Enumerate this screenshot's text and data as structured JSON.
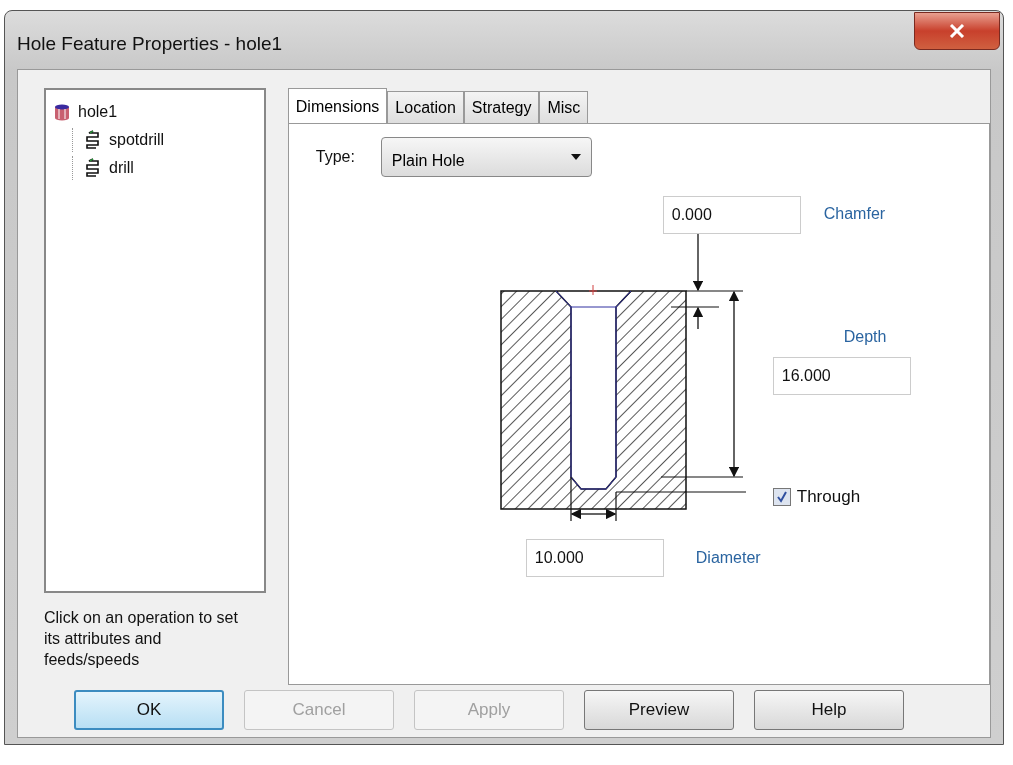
{
  "window": {
    "title": "Hole Feature Properties - hole1"
  },
  "tree": [
    {
      "label": "hole1",
      "kind": "feature",
      "children": [
        {
          "label": "spotdrill",
          "kind": "operation"
        },
        {
          "label": "drill",
          "kind": "operation"
        }
      ]
    }
  ],
  "hint": "Click on an operation to set its attributes and feeds/speeds",
  "tabs": [
    {
      "label": "Dimensions",
      "selected": true
    },
    {
      "label": "Location",
      "selected": false
    },
    {
      "label": "Strategy",
      "selected": false
    },
    {
      "label": "Misc",
      "selected": false
    }
  ],
  "type": {
    "label": "Type:",
    "value": "Plain Hole"
  },
  "chamfer": {
    "value": "0.000",
    "label": "Chamfer"
  },
  "depth": {
    "label": "Depth",
    "value": "16.000"
  },
  "through": {
    "label": "Through",
    "checked": true
  },
  "diameter": {
    "value": "10.000",
    "label": "Diameter"
  },
  "buttons": [
    {
      "label": "OK",
      "default": true,
      "disabled": false
    },
    {
      "label": "Cancel",
      "default": false,
      "disabled": true
    },
    {
      "label": "Apply",
      "default": false,
      "disabled": true
    },
    {
      "label": "Preview",
      "default": false,
      "disabled": false
    },
    {
      "label": "Help",
      "default": false,
      "disabled": false
    }
  ]
}
